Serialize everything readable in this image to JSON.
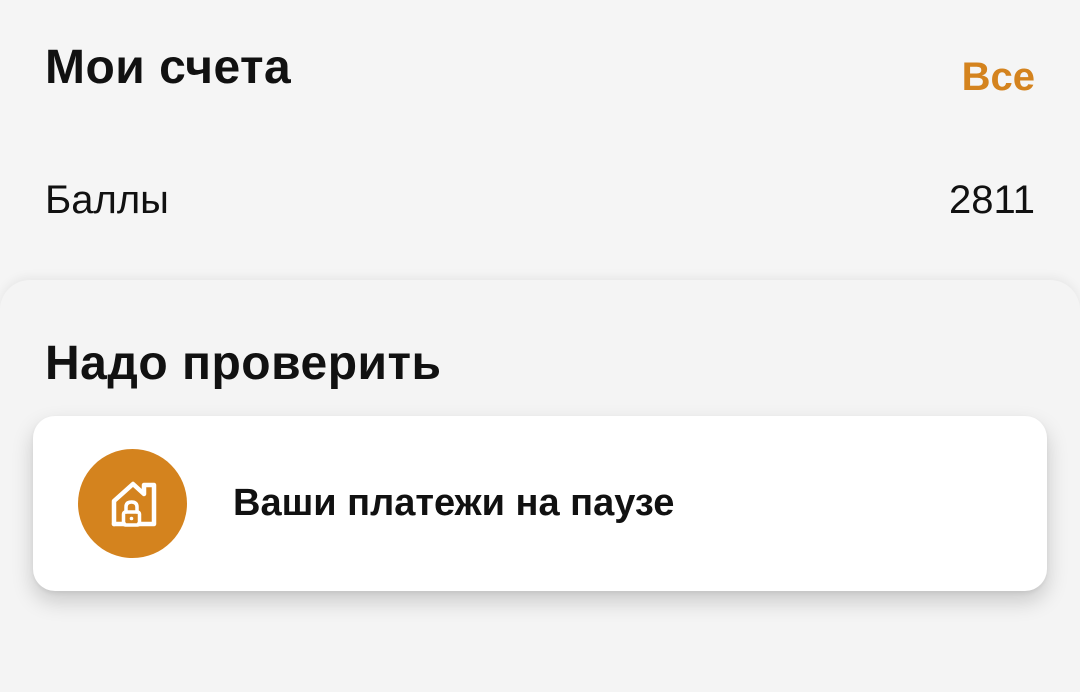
{
  "accounts": {
    "title": "Мои счета",
    "all_link": "Все",
    "points": {
      "label": "Баллы",
      "value": "2811"
    }
  },
  "check": {
    "title": "Надо проверить",
    "alert": {
      "icon": "house-lock-icon",
      "text": "Ваши платежи на паузе"
    }
  },
  "colors": {
    "accent": "#d4831e",
    "background": "#f5f5f5",
    "card": "#ffffff",
    "text": "#111111"
  }
}
